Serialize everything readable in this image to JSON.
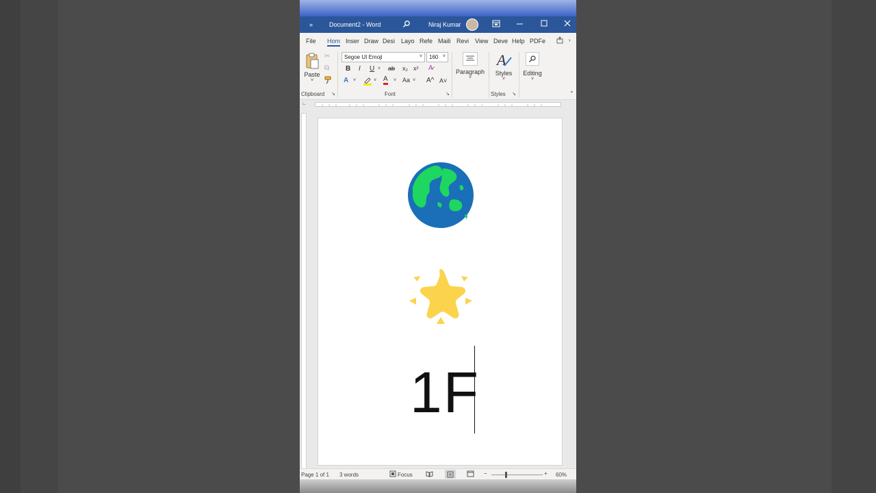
{
  "window": {
    "quick_access": "»",
    "title": "Document2 - Word",
    "user_name": "Niraj Kumar"
  },
  "tabs": [
    "File",
    "Hom",
    "Inser",
    "Draw",
    "Desi",
    "Layo",
    "Refe",
    "Maili",
    "Revi",
    "View",
    "Deve",
    "Help",
    "PDFe"
  ],
  "ribbon": {
    "clipboard": {
      "paste_label": "Paste",
      "group_label": "Clipboard"
    },
    "font": {
      "font_name": "Segoe UI Emoji",
      "font_size": "160",
      "group_label": "Font",
      "bold": "B",
      "italic": "I",
      "underline": "U",
      "strike": "ab",
      "subscript": "x₂",
      "superscript": "x²",
      "text_effects": "A",
      "highlight": "ab",
      "font_color": "A",
      "change_case": "Aa",
      "grow": "A^",
      "shrink": "A˅"
    },
    "paragraph": {
      "label": "Paragraph"
    },
    "styles": {
      "label": "Styles",
      "group_label": "Styles"
    },
    "editing": {
      "label": "Editing"
    }
  },
  "document": {
    "text": "1F"
  },
  "status": {
    "page": "Page 1 of 1",
    "words": "3 words",
    "focus": "Focus",
    "zoom": "60%"
  },
  "colors": {
    "titlebar": "#2b579a",
    "earth_land": "#1ed760",
    "earth_water": "#1a6fb8",
    "star": "#fcd34d"
  }
}
